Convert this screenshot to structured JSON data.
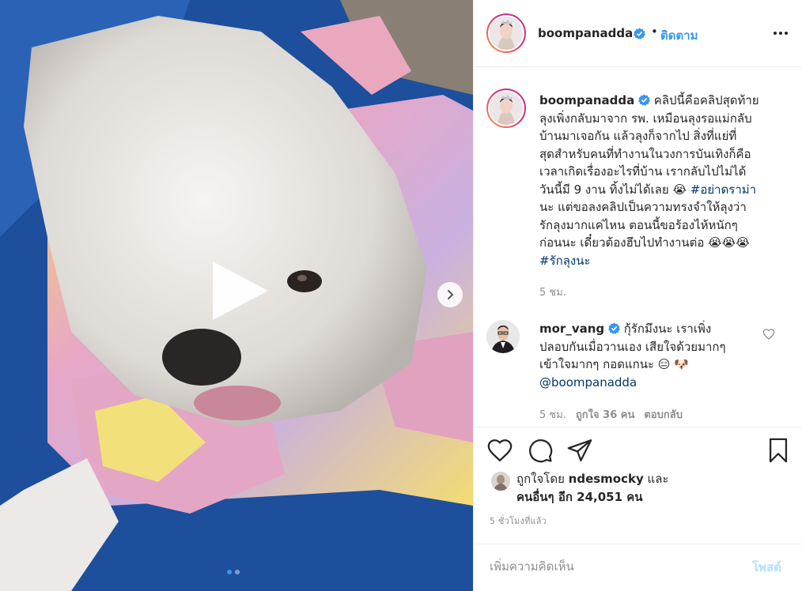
{
  "post": {
    "username": "boompanadda",
    "follow_label": "ติดตาม",
    "separator": "•",
    "caption_lines": [
      "คลิปนี้คือคลิปสุดท้าย",
      "ลุงเพิ่งกลับมาจาก รพ. เหมือนลุงรอแม่กลับ",
      "บ้านมาเจอกัน แล้วลุงก็จากไป สิ่งที่แย่ที่",
      "สุดสำหรับคนที่ทำงานในวงการบันเทิงก็คือ",
      "เวลาเกิดเรื่องอะไรที่บ้าน เรากลับไปไม่ได้",
      "วันนี้มี 9 งาน ทิ้งไม่ได้เลย 😭",
      "นะ แต่ขอลงคลิปเป็นความทรงจำให้ลุงว่า",
      "รักลุงมากแค่ไหน ตอนนี้ขอร้องไห้หนักๆ",
      "ก่อนนะ เดี๋ยวต้องฮึบไปทำงานต่อ 😭😭😭"
    ],
    "hashtag_1": "#อย่าดราม่า",
    "hashtag_2": "#รักลุงนะ",
    "caption_time": "5 ชม."
  },
  "comment": {
    "username": "mor_vang",
    "line_1": "กุ้รักมึงนะ เราเพิ่ง",
    "line_2": "ปลอบกันเมื่อวานเอง เสียใจด้วยมากๆ",
    "line_3": "เข้าใจมากๆ กอดแกนะ 😑 🐶",
    "mention": "@boompanadda",
    "time": "5 ชม.",
    "likes": "ถูกใจ 36 คน",
    "reply_label": "ตอบกลับ"
  },
  "likes": {
    "prefix": "ถูกใจโดย",
    "liker": "ndesmocky",
    "and": "และ",
    "others": "คนอื่นๆ อีก 24,051 คน"
  },
  "post_time": "5 ชั่วโมงที่แล้ว",
  "comment_box": {
    "placeholder": "เพิ่มความคิดเห็น",
    "post_label": "โพสต์"
  },
  "colors": {
    "link_blue": "#3897f0",
    "hashtag": "#00376b",
    "muted": "#8e8e8e",
    "post_disabled": "#b2dffc"
  },
  "icons": {
    "verified": "verified-badge-icon",
    "play": "play-icon",
    "next": "chevron-right-icon",
    "more": "more-horizontal-icon",
    "like": "heart-icon",
    "comment": "comment-bubble-icon",
    "share": "paper-plane-icon",
    "save": "bookmark-icon"
  },
  "carousel": {
    "slides": 2,
    "active_index": 0
  }
}
